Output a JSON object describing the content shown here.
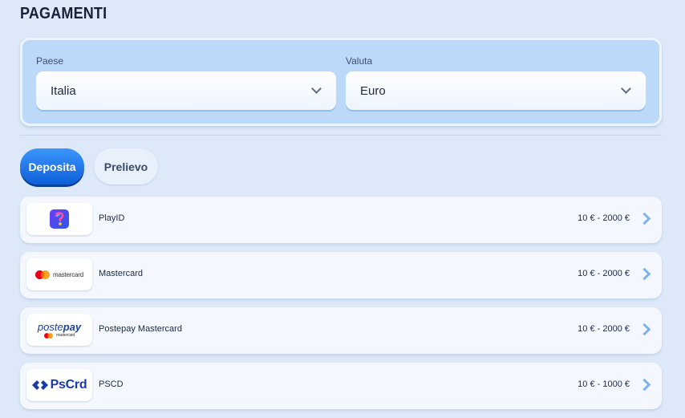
{
  "page": {
    "title": "PAGAMENTI"
  },
  "filters": {
    "country": {
      "label": "Paese",
      "value": "Italia"
    },
    "currency": {
      "label": "Valuta",
      "value": "Euro"
    }
  },
  "tabs": [
    {
      "label": "Deposita",
      "active": true
    },
    {
      "label": "Prelievo",
      "active": false
    }
  ],
  "methods": [
    {
      "name": "PlayID",
      "range": "10 € - 2000 €",
      "logo": "playid-logo"
    },
    {
      "name": "Mastercard",
      "range": "10 € - 2000 €",
      "logo": "mastercard-logo",
      "logo_text": "mastercard"
    },
    {
      "name": "Postepay Mastercard",
      "range": "10 € - 2000 €",
      "logo": "postepay-logo",
      "logo_text_1": "poste",
      "logo_text_2": "pay",
      "logo_sub": "mastercard"
    },
    {
      "name": "PSCD",
      "range": "10 € - 1000 €",
      "logo": "pscrd-logo",
      "logo_text": "PsCrd"
    }
  ],
  "colors": {
    "background": "#dde9f8",
    "panel": "#bcd9f9",
    "accent": "#0d5fd8",
    "chevron": "#7fb3ee"
  }
}
